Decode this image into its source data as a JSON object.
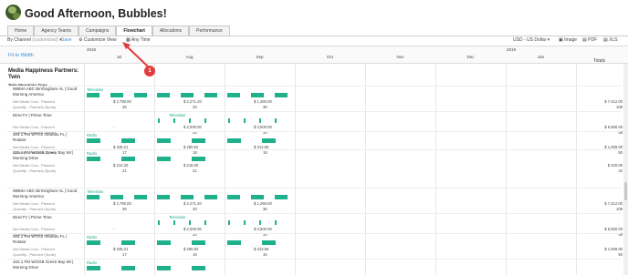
{
  "greeting": "Good Afternoon, Bubbles!",
  "tabs": [
    "Home",
    "Agency Teams",
    "Campaigns",
    "Flowchart",
    "Allocations",
    "Performance"
  ],
  "active_tab": "Flowchart",
  "toolbar": {
    "view_by": "By Channel",
    "view_by_note": "(customized)",
    "save": "Save",
    "customize": "Customize View",
    "time": "Any Time",
    "currency": "USD - US Dollar",
    "export_image": "Image",
    "export_pdf": "PDF",
    "export_xls": "XLS"
  },
  "grid": {
    "fit_link": "Fit to Width",
    "totals_label": "Totals",
    "year1": "2018",
    "year2": "2019",
    "months": [
      "Jul",
      "Aug",
      "Sep",
      "Oct",
      "Nov",
      "Dec",
      "Jan"
    ]
  },
  "partner": "Media Happiness Partners: Twin",
  "team": "Twin Mountain Tops",
  "blocks": [
    {
      "name": "WBMA ABC Birmingham AL | Good Morning America",
      "channel": "Television",
      "cost_label": "Net Media Cost - Planned",
      "qty_label": "Quantity - Planned (Spots)",
      "values": [
        "$ 2,790.00",
        "$ 2,271.20",
        "$ 1,260.00"
      ],
      "qtys": [
        "36",
        "33",
        "36"
      ],
      "total_cost": "$ 7,412.00",
      "total_qty": "108"
    },
    {
      "name": "DirecTV | Prime Time",
      "channel": "Television",
      "cost_label": "Net Media Cost - Planned",
      "qty_label": "Quantity - Planned (Spots)",
      "values": [
        "-",
        "$ 2,000.00",
        "$ 3,500.00"
      ],
      "qtys": [
        "",
        "20",
        "30"
      ],
      "total_cost": "$ 5,500.00",
      "total_qty": "48"
    },
    {
      "name": "104.1 FM WTKS Orlando FL | Rotator",
      "channel": "Radio",
      "cost_label": "Net Media Cost - Planned",
      "qty_label": "Quantity - Planned (Spots)",
      "values": [
        "$ 345.21",
        "$ 280.82",
        "$ 313.65"
      ],
      "qtys": [
        "17",
        "18",
        "15"
      ],
      "total_cost": "$ 1,939.00",
      "total_qty": "50"
    },
    {
      "name": "103.1 FM WOGB Green Bay WI | Morning Drive",
      "channel": "Radio",
      "cost_label": "Net Media Cost - Planned",
      "qty_label": "Quantity - Planned (Spots)",
      "values": [
        "$ 214.20",
        "$ 216.00",
        ""
      ],
      "qtys": [
        "21",
        "21",
        ""
      ],
      "total_cost": "$ 420.00",
      "total_qty": "42"
    },
    {
      "name": "WBMA ABC Birmingham AL | Good Morning America",
      "channel": "Television",
      "cost_label": "Net Media Cost - Planned",
      "qty_label": "Quantity - Planned (Spots)",
      "values": [
        "$ 2,790.00",
        "$ 2,271.20",
        "$ 1,260.00"
      ],
      "qtys": [
        "36",
        "33",
        "36"
      ],
      "total_cost": "$ 7,412.00",
      "total_qty": "108"
    },
    {
      "name": "DirecTV | Prime Time",
      "channel": "Television",
      "cost_label": "Net Media Cost - Planned",
      "qty_label": "Quantity - Planned (Spots)",
      "values": [
        "-",
        "$ 2,000.00",
        "$ 3,500.00"
      ],
      "qtys": [
        "",
        "20",
        "30"
      ],
      "total_cost": "$ 5,500.00",
      "total_qty": "48"
    },
    {
      "name": "104.1 FM WTKS Orlando FL | Rotator",
      "channel": "Radio",
      "cost_label": "Net Media Cost - Planned",
      "qty_label": "Quantity - Planned (Spots)",
      "values": [
        "$ 345.21",
        "$ 280.82",
        "$ 313.65"
      ],
      "qtys": [
        "17",
        "18",
        "15"
      ],
      "total_cost": "$ 1,939.00",
      "total_qty": "50"
    },
    {
      "name": "103.1 FM WOGB Green Bay WI | Morning Drive",
      "channel": "Radio",
      "cost_label": "",
      "qty_label": "",
      "values": [
        "",
        "",
        ""
      ],
      "qtys": [
        "",
        "",
        ""
      ],
      "total_cost": "",
      "total_qty": ""
    }
  ],
  "annotation": "1",
  "colors": {
    "bar": "#1fb08c",
    "accent": "#3a8fd6",
    "annotation": "#e23b3b"
  }
}
